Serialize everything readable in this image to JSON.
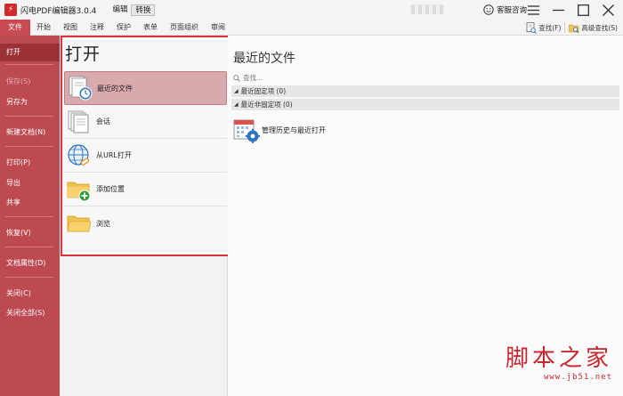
{
  "titlebar": {
    "title": "闪电PDF编辑器3.0.4",
    "mode_tabs": [
      "编辑",
      "转换"
    ],
    "support_label": "客服咨询"
  },
  "menubar": {
    "items": [
      "文件",
      "开始",
      "视图",
      "注释",
      "保护",
      "表单",
      "页面组织",
      "审阅"
    ],
    "find_label": "查找(F)",
    "advanced_find_label": "高级查找(S)"
  },
  "leftnav": {
    "items": [
      {
        "label": "打开",
        "state": "active"
      },
      {
        "label": "保存(S)",
        "state": "disabled"
      },
      {
        "label": "另存为",
        "state": "normal"
      },
      {
        "label": "新建文档(N)",
        "state": "normal"
      },
      {
        "label": "打印(P)",
        "state": "normal"
      },
      {
        "label": "导出",
        "state": "normal"
      },
      {
        "label": "共享",
        "state": "normal"
      },
      {
        "label": "恢复(V)",
        "state": "normal"
      },
      {
        "label": "文档属性(D)",
        "state": "normal"
      },
      {
        "label": "关闭(C)",
        "state": "normal"
      },
      {
        "label": "关闭全部(S)",
        "state": "normal"
      }
    ]
  },
  "open_panel": {
    "title": "打开",
    "items": [
      {
        "label": "最近的文件",
        "icon": "recent-files-icon"
      },
      {
        "label": "会话",
        "icon": "session-icon"
      },
      {
        "label": "从URL打开",
        "icon": "globe-link-icon"
      },
      {
        "label": "添加位置",
        "icon": "add-folder-icon"
      },
      {
        "label": "浏览",
        "icon": "folder-icon"
      }
    ]
  },
  "content": {
    "title": "最近的文件",
    "search_placeholder": "查找...",
    "pinned_label": "最近固定项 (0)",
    "unpinned_label": "最近非固定项 (0)",
    "history_label": "管理历史与最近打开"
  },
  "watermark": {
    "main": "脚本之家",
    "url": "www.jb51.net"
  },
  "colors": {
    "accent": "#bd4a51",
    "highlight_border": "#d9343b"
  }
}
